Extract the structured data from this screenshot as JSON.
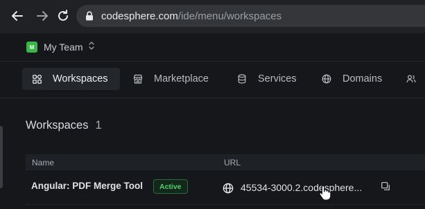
{
  "browser": {
    "url_host": "codesphere.com",
    "url_path": "/ide/menu/workspaces"
  },
  "team": {
    "avatar_initial": "M",
    "name": "My Team"
  },
  "tabs": [
    {
      "label": "Workspaces"
    },
    {
      "label": "Marketplace"
    },
    {
      "label": "Services"
    },
    {
      "label": "Domains"
    }
  ],
  "section": {
    "title": "Workspaces",
    "count": "1"
  },
  "table": {
    "columns": [
      "Name",
      "URL"
    ],
    "rows": [
      {
        "name": "Angular: PDF Merge Tool",
        "status": "Active",
        "url": "45534-3000.2.codesphere..."
      }
    ]
  },
  "colors": {
    "accent_green": "#4fd36b",
    "avatar_green": "#3bb54a",
    "background": "#15171b"
  }
}
